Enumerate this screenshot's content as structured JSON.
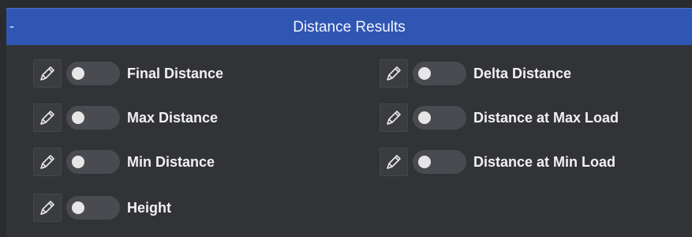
{
  "header": {
    "collapse_symbol": "-",
    "title": "Distance Results"
  },
  "items": [
    {
      "label": "Final Distance",
      "enabled": false,
      "edit_icon": "pencil-icon"
    },
    {
      "label": "Max Distance",
      "enabled": false,
      "edit_icon": "pencil-icon"
    },
    {
      "label": "Min Distance",
      "enabled": false,
      "edit_icon": "pencil-icon"
    },
    {
      "label": "Height",
      "enabled": false,
      "edit_icon": "pencil-icon"
    },
    {
      "label": "Delta Distance",
      "enabled": false,
      "edit_icon": "pencil-icon"
    },
    {
      "label": "Distance at Max Load",
      "enabled": false,
      "edit_icon": "pencil-icon"
    },
    {
      "label": "Distance at Min Load",
      "enabled": false,
      "edit_icon": "pencil-icon"
    }
  ],
  "colors": {
    "header_background": "#2f56b3",
    "panel_background": "#323337",
    "toggle_off": "#4a4b50",
    "text": "#f1f1f1"
  }
}
